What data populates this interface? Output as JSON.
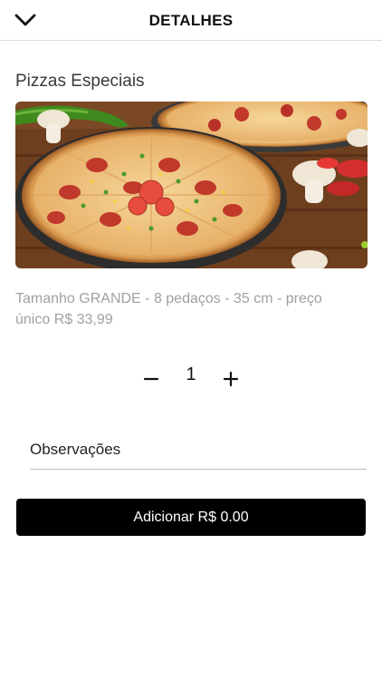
{
  "header": {
    "title": "DETALHES",
    "back_icon": "chevron-down-icon"
  },
  "product": {
    "category": "Pizzas Especiais",
    "image_alt": "pizza-photo",
    "description": "Tamanho GRANDE - 8 pedaços - 35 cm - preço único R$ 33,99"
  },
  "quantity": {
    "value": "1",
    "minus_icon": "minus-icon",
    "plus_icon": "plus-icon"
  },
  "notes": {
    "placeholder": "Observações",
    "value": ""
  },
  "add_button": {
    "label": "Adicionar R$ 0.00"
  },
  "colors": {
    "button_bg": "#000000",
    "button_text": "#ffffff",
    "description_text": "#a0a0a0",
    "divider": "#dcdcdc"
  }
}
